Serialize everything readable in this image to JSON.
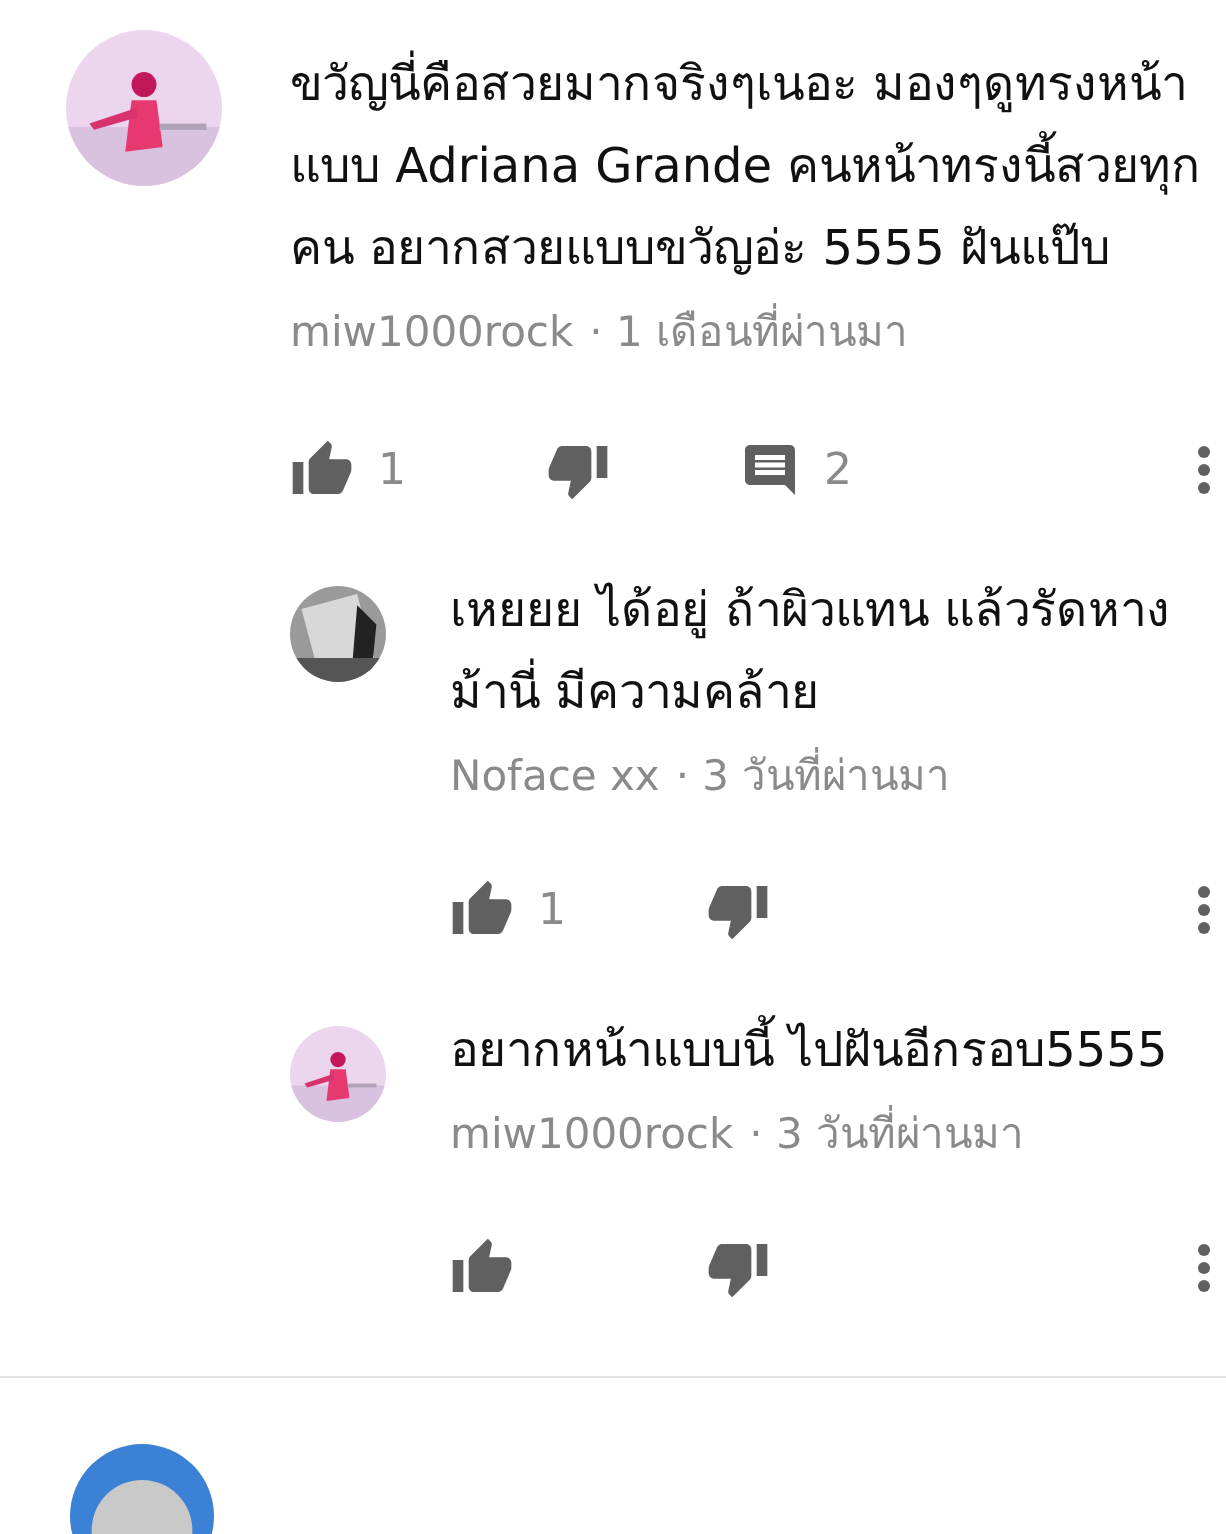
{
  "comments": [
    {
      "text": "ขวัญนี่คือสวยมากจริงๆเนอะ มองๆดูทรงหน้าแบบ Adriana Grande  คนหน้าทรงนี้สวยทุกคน อยากสวยแบบขวัญอ่ะ 5555 ฝันแป๊บ",
      "author": "miw1000rock",
      "time": "· 1 เดือนที่ผ่านมา",
      "likes": "1",
      "replies": "2",
      "avatar": {
        "kind": "picture"
      },
      "children": [
        {
          "text": "เหยยย ได้อยู่ ถ้าผิวแทน แล้วรัดหางม้านี่ มีความคล้าย",
          "author": "Noface xx",
          "time": "· 3 วันที่ผ่านมา",
          "likes": "1",
          "avatar": {
            "kind": "picture"
          }
        },
        {
          "text": "อยากหน้าแบบนี้ ไปฝันอีกรอบ5555",
          "author": "miw1000rock",
          "time": "· 3 วันที่ผ่านมา",
          "avatar": {
            "kind": "picture"
          }
        }
      ]
    },
    {
      "avatar": {
        "kind": "picture"
      }
    }
  ]
}
